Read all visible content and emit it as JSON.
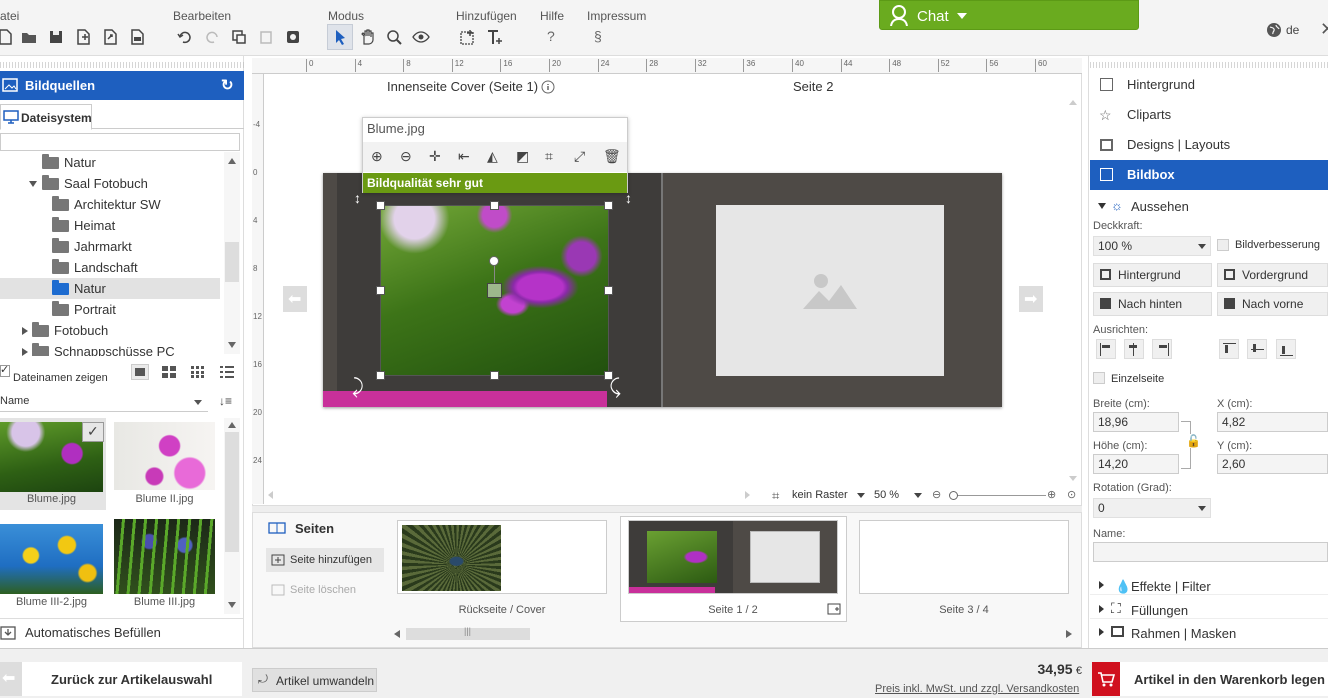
{
  "menu": {
    "datei": "atei",
    "bearbeiten": "Bearbeiten",
    "modus": "Modus",
    "hinzufuegen": "Hinzufügen",
    "hilfe": "Hilfe",
    "impressum": "Impressum",
    "hilfe_icon": "?",
    "impressum_icon": "§"
  },
  "chat": {
    "label": "Chat"
  },
  "lang": {
    "label": "de"
  },
  "left": {
    "title": "Bildquellen",
    "tab": "Dateisystem",
    "tree": [
      "Natur",
      "Saal Fotobuch",
      "Architektur SW",
      "Heimat",
      "Jahrmarkt",
      "Landschaft",
      "Natur",
      "Portrait",
      "Fotobuch",
      "Schnappschüsse PC"
    ],
    "show_names": "Dateinamen zeigen",
    "sort": "Name",
    "thumbs": [
      "Blume.jpg",
      "Blume II.jpg",
      "Blume III-2.jpg",
      "Blume III.jpg"
    ],
    "autofill": "Automatisches Befüllen"
  },
  "canvas": {
    "page_left": "Innenseite Cover (Seite 1)",
    "page_right": "Seite 2",
    "file": "Blume.jpg",
    "quality": "Bildqualität sehr gut",
    "ruler_top": [
      "0",
      "4",
      "8",
      "12",
      "16",
      "20",
      "24",
      "28",
      "32",
      "36",
      "40",
      "44",
      "48",
      "52",
      "56",
      "60"
    ],
    "ruler_left": [
      "-4",
      "0",
      "4",
      "8",
      "12",
      "16",
      "20",
      "24"
    ],
    "grid": "kein Raster",
    "zoom": "50 %"
  },
  "pages": {
    "title": "Seiten",
    "add": "Seite hinzufügen",
    "delete": "Seite löschen",
    "items": [
      "Rückseite / Cover",
      "Seite 1 / 2",
      "Seite 3 / 4"
    ]
  },
  "right": {
    "hintergrund": "Hintergrund",
    "cliparts": "Cliparts",
    "designs": "Designs | Layouts",
    "bildbox": "Bildbox",
    "aussehen": "Aussehen",
    "deckkraft_label": "Deckkraft:",
    "deckkraft": "100 %",
    "bildverbesserung": "Bildverbesserung",
    "btn_hintergrund": "Hintergrund",
    "btn_vordergrund": "Vordergrund",
    "btn_nach_hinten": "Nach hinten",
    "btn_nach_vorne": "Nach vorne",
    "ausrichten": "Ausrichten:",
    "einzelseite": "Einzelseite",
    "breite_label": "Breite (cm):",
    "breite": "18,96",
    "x_label": "X (cm):",
    "x": "4,82",
    "hoehe_label": "Höhe (cm):",
    "hoehe": "14,20",
    "y_label": "Y (cm):",
    "y": "2,60",
    "rotation_label": "Rotation (Grad):",
    "rotation": "0",
    "name_label": "Name:",
    "effekte": "Effekte | Filter",
    "fuellungen": "Füllungen",
    "rahmen": "Rahmen | Masken"
  },
  "footer": {
    "back": "Zurück zur Artikelauswahl",
    "convert": "Artikel umwandeln",
    "price": "34,95",
    "currency": "€",
    "price_note": "Preis inkl. MwSt. und zzgl. Versandkosten",
    "cart": "Artikel in den Warenkorb legen"
  },
  "colors": {
    "accent": "#1e5fbf",
    "chat": "#6aab1f",
    "quality": "#6a9a12",
    "cart": "#d0101e",
    "magenta": "#c8309a"
  }
}
